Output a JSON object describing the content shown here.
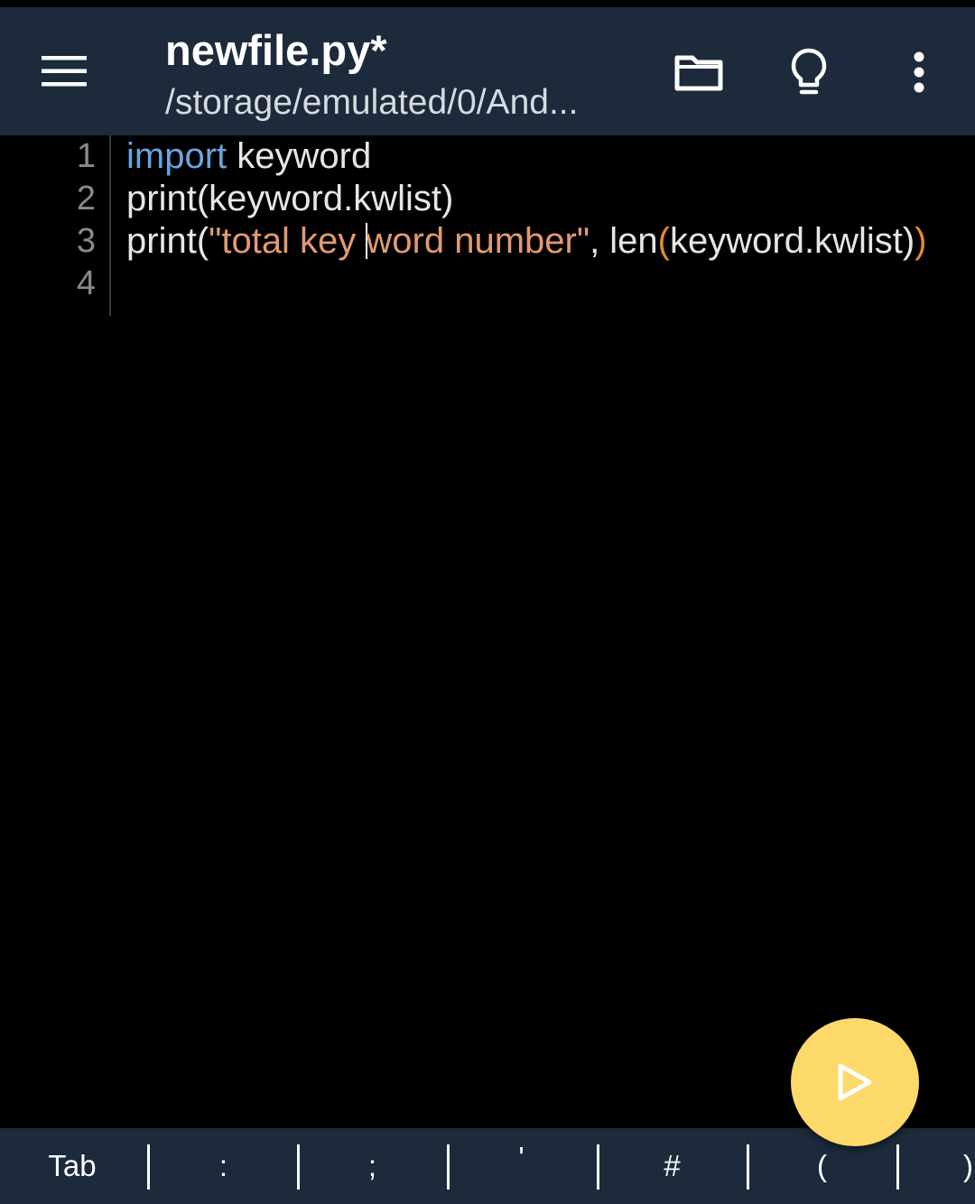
{
  "colors": {
    "appbar_bg": "#1c2a3b",
    "editor_bg": "#000000",
    "keyword": "#6aa5e0",
    "string": "#e29a72",
    "bracket_match": "#e38b2c",
    "run_button": "#fdd96a"
  },
  "toolbar": {
    "title": "newfile.py*",
    "subtitle": "/storage/emulated/0/And...",
    "icons": [
      "menu-icon",
      "folder-icon",
      "lightbulb-icon",
      "more-vert-icon"
    ]
  },
  "editor": {
    "line_numbers": [
      "1",
      "2",
      "3",
      "4"
    ],
    "lines": [
      {
        "kw": "import",
        "rest": " keyword"
      },
      {
        "text": "print(keyword.kwlist)"
      },
      {
        "pre": "print(",
        "str_a": "\"total key ",
        "str_b": "word number\"",
        "mid": ", len",
        "open_paren": "(",
        "args": "keyword.kwlist)",
        "close_paren": ")"
      },
      {
        "text": ""
      }
    ]
  },
  "run_button": {
    "icon": "play-icon"
  },
  "keybar": {
    "keys": [
      "Tab",
      ":",
      ";",
      "'",
      "#",
      "(",
      ")"
    ]
  }
}
